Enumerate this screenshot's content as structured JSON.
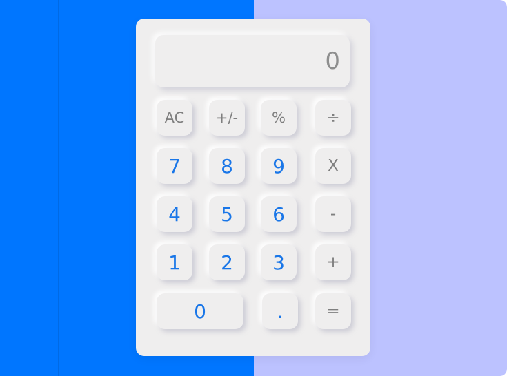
{
  "colors": {
    "left_background": "#0076ff",
    "right_background": "#bcc2ff",
    "calculator_body": "#efeeee",
    "number_text": "#1976e8",
    "operator_text": "#7f7f7f"
  },
  "display": {
    "value": "0"
  },
  "keys": {
    "ac": "AC",
    "sign": "+/-",
    "percent": "%",
    "divide": "÷",
    "seven": "7",
    "eight": "8",
    "nine": "9",
    "multiply": "X",
    "four": "4",
    "five": "5",
    "six": "6",
    "minus": "-",
    "one": "1",
    "two": "2",
    "three": "3",
    "plus": "+",
    "zero": "0",
    "decimal": ".",
    "equals": "="
  }
}
